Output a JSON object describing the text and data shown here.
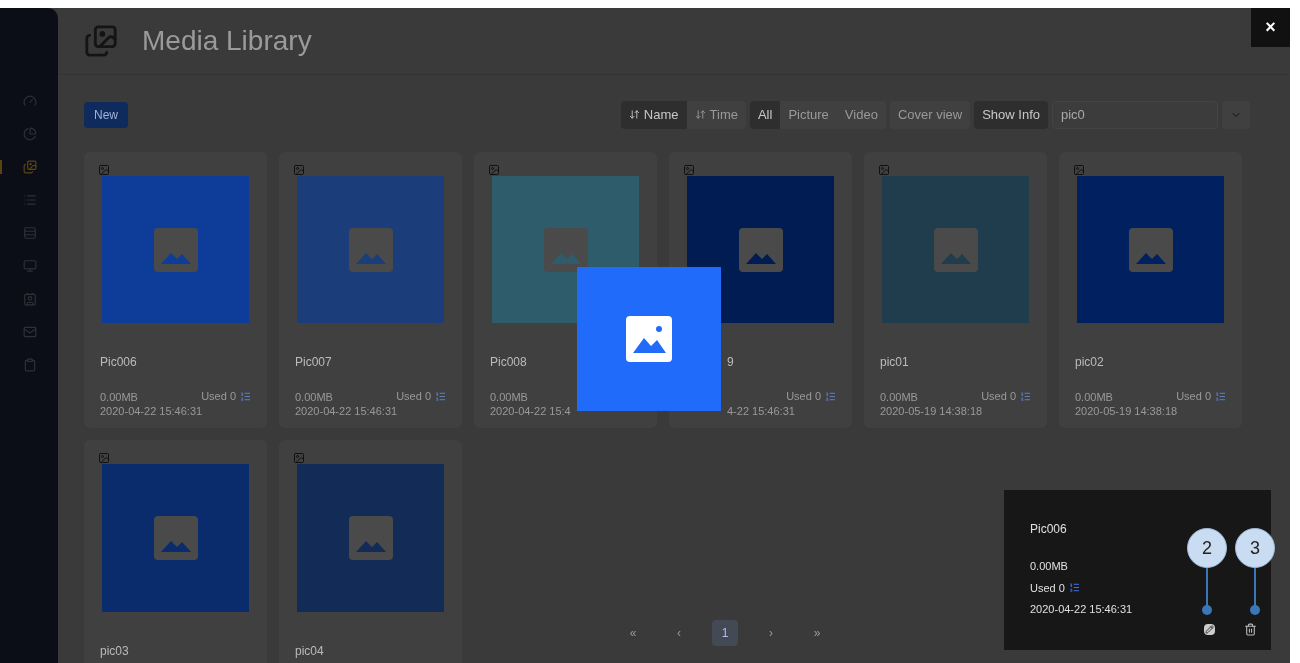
{
  "sidebar": {
    "items": [
      {
        "selected": false
      },
      {
        "selected": false
      },
      {
        "selected": true
      },
      {
        "selected": false
      },
      {
        "selected": false
      },
      {
        "selected": false
      },
      {
        "selected": false
      },
      {
        "selected": false
      },
      {
        "selected": false
      }
    ]
  },
  "header": {
    "title": "Media Library",
    "close": "×"
  },
  "toolbar": {
    "new_button": "New",
    "sort": [
      {
        "label": "Name",
        "selected": true
      },
      {
        "label": "Time",
        "selected": false
      }
    ],
    "filter": [
      {
        "label": "All",
        "selected": true
      },
      {
        "label": "Picture",
        "selected": false
      },
      {
        "label": "Video",
        "selected": false
      }
    ],
    "cover_view": {
      "label": "Cover view",
      "selected": false
    },
    "show_info": {
      "label": "Show Info",
      "selected": true
    },
    "search": {
      "value": "pic0"
    }
  },
  "cards": [
    {
      "kind": "full",
      "name": "Pic006",
      "size": "0.00MB",
      "used": "Used 0",
      "date": "2020-04-22 15:46:31",
      "color": "#0d3d99"
    },
    {
      "kind": "full",
      "name": "Pic007",
      "size": "0.00MB",
      "used": "Used 0",
      "date": "2020-04-22 15:46:31",
      "color": "#1b3e7a"
    },
    {
      "kind": "full",
      "name": "Pic008",
      "size": "0.00MB",
      "date": "2020-04-22 15:4",
      "color": "#2f5c6b"
    },
    {
      "kind": "covered",
      "name": "9",
      "used": "Used 0",
      "date": "4-22 15:46:31",
      "color": "#001c52"
    },
    {
      "kind": "full",
      "name": "pic01",
      "size": "0.00MB",
      "used": "Used 0",
      "date": "2020-05-19 14:38:18",
      "color": "#1f3d4c"
    },
    {
      "kind": "full",
      "name": "pic02",
      "size": "0.00MB",
      "used": "Used 0",
      "date": "2020-05-19 14:38:18",
      "color": "#00205f"
    },
    {
      "kind": "full",
      "name": "pic03",
      "color": "#0a2b6c"
    },
    {
      "kind": "full",
      "name": "pic04",
      "color": "#132c57"
    }
  ],
  "pagination": [
    {
      "label": "«",
      "selected": false
    },
    {
      "label": "‹",
      "selected": false
    },
    {
      "label": "1",
      "selected": true
    },
    {
      "label": "›",
      "selected": false
    },
    {
      "label": "»",
      "selected": false
    }
  ],
  "info_panel": {
    "name": "Pic006",
    "size": "0.00MB",
    "used": "Used 0",
    "date": "2020-04-22 15:46:31"
  },
  "callouts": [
    "2",
    "3"
  ]
}
